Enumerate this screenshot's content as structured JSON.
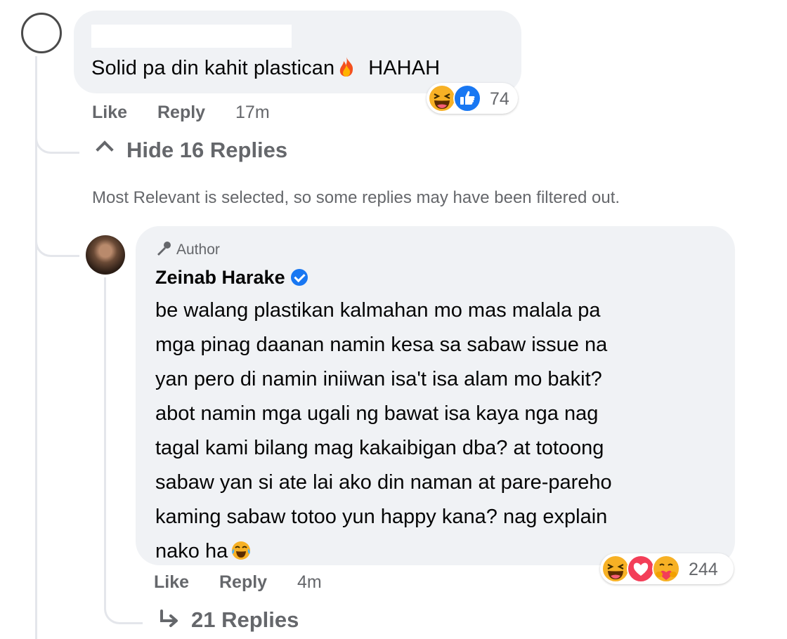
{
  "top_comment": {
    "text_before_emoji": "Solid pa din kahit plastican",
    "emoji_1": "fire-emoji",
    "text_after_emoji": "HAHAH",
    "reactions": {
      "icons": [
        "laughing-emoji",
        "like-thumb"
      ],
      "count": "74"
    },
    "actions": {
      "like": "Like",
      "reply": "Reply",
      "time": "17m"
    }
  },
  "replies_toggle": {
    "label": "Hide 16 Replies",
    "icon": "chevron-up-icon"
  },
  "filter_notice": "Most Relevant is selected, so some replies may have been filtered out.",
  "reply": {
    "badge_label": "Author",
    "badge_icon": "microphone-icon",
    "author": "Zeinab Harake",
    "verified_icon": "verified-icon",
    "body_lines": [
      "be walang plastikan kalmahan mo mas malala pa",
      "mga pinag daanan namin kesa sa sabaw issue na",
      "yan pero di namin iniiwan isa't isa alam mo bakit?",
      "abot namin mga ugali ng bawat isa kaya nga nag",
      "tagal kami bilang mag kakaibigan dba? at totoong",
      "sabaw yan si ate lai ako din naman at pare-pareho",
      "kaming sabaw totoo yun happy kana? nag explain",
      "nako ha"
    ],
    "body_emoji": "crying-laughing-emoji",
    "reactions": {
      "icons": [
        "laughing-emoji",
        "love-heart",
        "care-hug"
      ],
      "count": "244"
    },
    "actions": {
      "like": "Like",
      "reply": "Reply",
      "time": "4m"
    }
  },
  "more_replies": {
    "label": "21 Replies",
    "icon": "reply-arrow-icon"
  },
  "colors": {
    "bubble": "#f0f2f5",
    "meta_text": "#65676b",
    "like_blue": "#1877f2",
    "love_red": "#f33e58",
    "haha_yellow": "#f7b125"
  }
}
